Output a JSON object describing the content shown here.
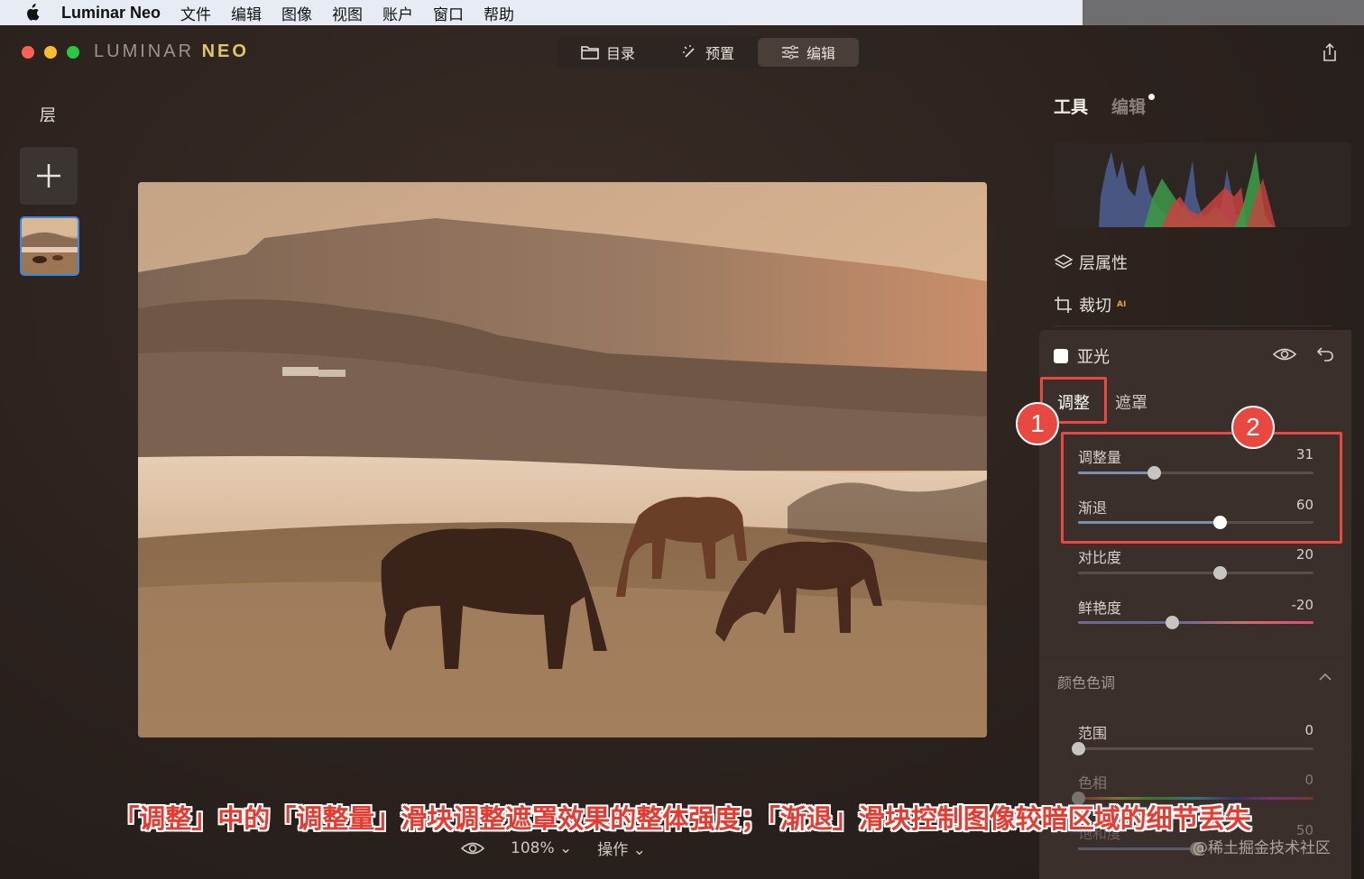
{
  "menubar": {
    "app_name": "Luminar Neo",
    "items": [
      "文件",
      "编辑",
      "图像",
      "视图",
      "账户",
      "窗口",
      "帮助"
    ]
  },
  "window": {
    "brand_main": "LUMINAR",
    "brand_accent": "NEO",
    "mode_tabs": [
      {
        "label": "目录",
        "icon": "folder-icon"
      },
      {
        "label": "预置",
        "icon": "magic-wand-icon"
      },
      {
        "label": "编辑",
        "icon": "sliders-icon",
        "active": true
      }
    ],
    "traffic_colors": [
      "#fe5f57",
      "#febc2e",
      "#28c840"
    ]
  },
  "left_panel": {
    "title": "层"
  },
  "bottom_bar": {
    "zoom": "108%",
    "actions": "操作"
  },
  "right_panel": {
    "tab_tools": "工具",
    "tab_edits": "编辑",
    "layer_properties": "层属性",
    "crop": "裁切",
    "crop_badge": "AI",
    "matte": {
      "title": "亚光",
      "subtab_adjust": "调整",
      "subtab_mask": "遮罩",
      "sliders": [
        {
          "label": "调整量",
          "value": "31",
          "fraction": 0.32
        },
        {
          "label": "渐退",
          "value": "60",
          "fraction": 0.6
        },
        {
          "label": "对比度",
          "value": "20",
          "fraction": 0.6
        },
        {
          "label": "鲜艳度",
          "value": "-20",
          "fraction": 0.4
        }
      ]
    },
    "color_tone": {
      "title": "颜色色调",
      "sliders": [
        {
          "label": "范围",
          "value": "0",
          "fraction": 0.0
        },
        {
          "label": "色相",
          "value": "0",
          "fraction": 0.0
        },
        {
          "label": "饱和度",
          "value": "50",
          "fraction": 0.5
        }
      ]
    }
  },
  "annotations": {
    "marker_1": "1",
    "marker_2": "2",
    "caption": "「调整」中的「调整量」滑块调整遮罩效果的整体强度；「渐退」滑块控制图像较暗区域的细节丢失",
    "watermark": "@稀土掘金技术社区",
    "color": "#e8483f"
  }
}
